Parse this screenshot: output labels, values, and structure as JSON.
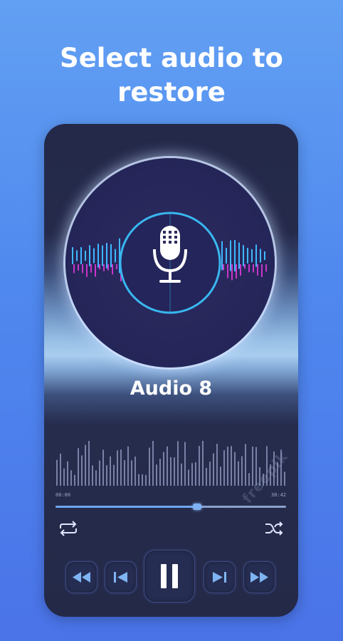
{
  "header": {
    "line1": "Select audio to",
    "line2": "restore"
  },
  "player": {
    "track_title": "Audio 8",
    "time_elapsed": "00:00",
    "time_total": "38:42",
    "progress": 0.615,
    "watermark": "freepik"
  },
  "icons": {
    "repeat": "repeat-icon",
    "shuffle": "shuffle-icon",
    "rewind": "rewind-icon",
    "previous": "skip-previous-icon",
    "pause": "pause-icon",
    "next": "skip-next-icon",
    "fast_forward": "fast-forward-icon",
    "microphone": "microphone-icon"
  },
  "colors": {
    "background": "#5b93f0",
    "card": "#252a4b",
    "accent_blue": "#3fb8ff",
    "accent_magenta": "#c737c8",
    "progress": "#6fa6f2"
  }
}
